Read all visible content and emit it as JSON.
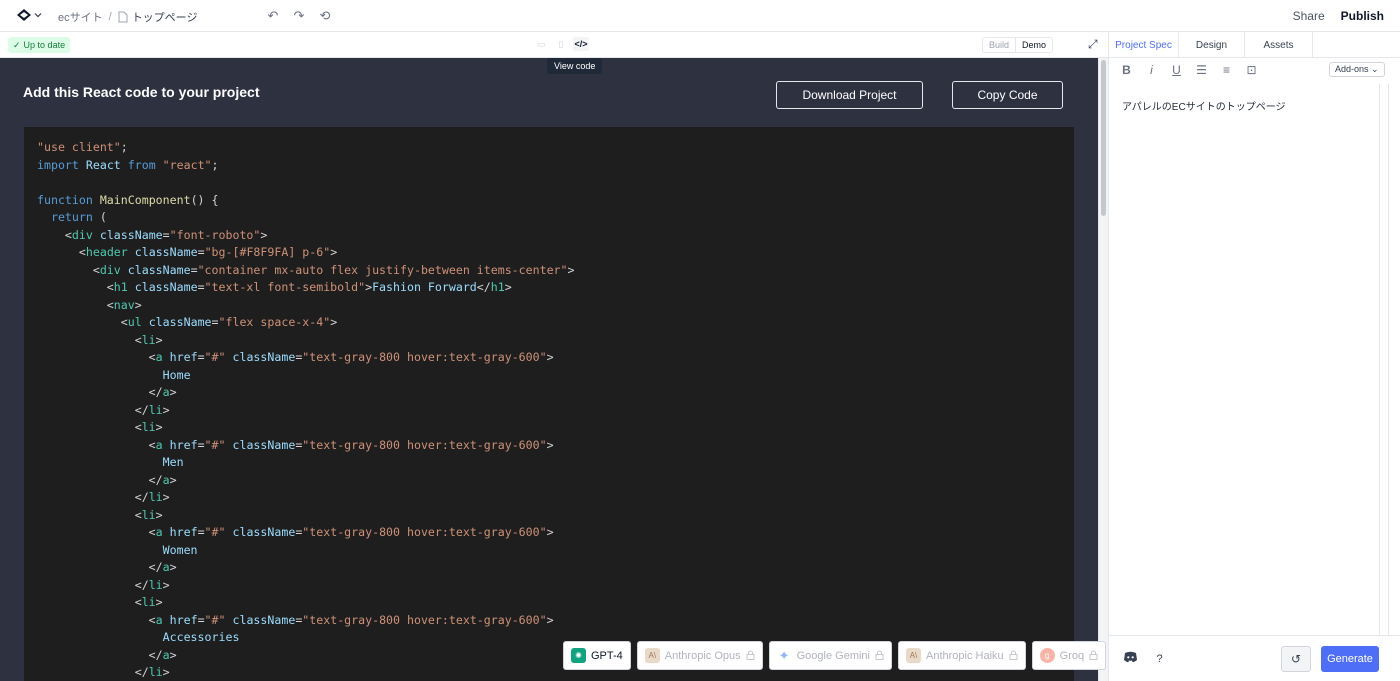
{
  "breadcrumb": {
    "project": "ecサイト",
    "separator": "/",
    "page": "トップページ"
  },
  "header": {
    "share": "Share",
    "publish": "Publish"
  },
  "status": {
    "label": "Up to date"
  },
  "mode": {
    "build": "Build",
    "demo": "Demo"
  },
  "tooltip": "View code",
  "main": {
    "title": "Add this React code to your project",
    "download_label": "Download Project",
    "copy_label": "Copy Code"
  },
  "code_lines": [
    [
      {
        "c": "s",
        "t": "\"use client\""
      },
      {
        "c": "p",
        "t": ";"
      }
    ],
    [
      {
        "c": "k",
        "t": "import"
      },
      {
        "c": "p",
        "t": " "
      },
      {
        "c": "v",
        "t": "React"
      },
      {
        "c": "p",
        "t": " "
      },
      {
        "c": "k",
        "t": "from"
      },
      {
        "c": "p",
        "t": " "
      },
      {
        "c": "s",
        "t": "\"react\""
      },
      {
        "c": "p",
        "t": ";"
      }
    ],
    [],
    [
      {
        "c": "k",
        "t": "function"
      },
      {
        "c": "p",
        "t": " "
      },
      {
        "c": "f",
        "t": "MainComponent"
      },
      {
        "c": "p",
        "t": "() {"
      }
    ],
    [
      {
        "c": "p",
        "t": "  "
      },
      {
        "c": "k",
        "t": "return"
      },
      {
        "c": "p",
        "t": " ("
      }
    ],
    [
      {
        "c": "p",
        "t": "    <"
      },
      {
        "c": "t",
        "t": "div"
      },
      {
        "c": "p",
        "t": " "
      },
      {
        "c": "a",
        "t": "className"
      },
      {
        "c": "p",
        "t": "="
      },
      {
        "c": "s",
        "t": "\"font-roboto\""
      },
      {
        "c": "p",
        "t": ">"
      }
    ],
    [
      {
        "c": "p",
        "t": "      <"
      },
      {
        "c": "t",
        "t": "header"
      },
      {
        "c": "p",
        "t": " "
      },
      {
        "c": "a",
        "t": "className"
      },
      {
        "c": "p",
        "t": "="
      },
      {
        "c": "s",
        "t": "\"bg-[#F8F9FA] p-6\""
      },
      {
        "c": "p",
        "t": ">"
      }
    ],
    [
      {
        "c": "p",
        "t": "        <"
      },
      {
        "c": "t",
        "t": "div"
      },
      {
        "c": "p",
        "t": " "
      },
      {
        "c": "a",
        "t": "className"
      },
      {
        "c": "p",
        "t": "="
      },
      {
        "c": "s",
        "t": "\"container mx-auto flex justify-between items-center\""
      },
      {
        "c": "p",
        "t": ">"
      }
    ],
    [
      {
        "c": "p",
        "t": "          <"
      },
      {
        "c": "t",
        "t": "h1"
      },
      {
        "c": "p",
        "t": " "
      },
      {
        "c": "a",
        "t": "className"
      },
      {
        "c": "p",
        "t": "="
      },
      {
        "c": "s",
        "t": "\"text-xl font-semibold\""
      },
      {
        "c": "p",
        "t": ">"
      },
      {
        "c": "v",
        "t": "Fashion Forward"
      },
      {
        "c": "p",
        "t": "</"
      },
      {
        "c": "t",
        "t": "h1"
      },
      {
        "c": "p",
        "t": ">"
      }
    ],
    [
      {
        "c": "p",
        "t": "          <"
      },
      {
        "c": "t",
        "t": "nav"
      },
      {
        "c": "p",
        "t": ">"
      }
    ],
    [
      {
        "c": "p",
        "t": "            <"
      },
      {
        "c": "t",
        "t": "ul"
      },
      {
        "c": "p",
        "t": " "
      },
      {
        "c": "a",
        "t": "className"
      },
      {
        "c": "p",
        "t": "="
      },
      {
        "c": "s",
        "t": "\"flex space-x-4\""
      },
      {
        "c": "p",
        "t": ">"
      }
    ],
    [
      {
        "c": "p",
        "t": "              <"
      },
      {
        "c": "t",
        "t": "li"
      },
      {
        "c": "p",
        "t": ">"
      }
    ],
    [
      {
        "c": "p",
        "t": "                <"
      },
      {
        "c": "t",
        "t": "a"
      },
      {
        "c": "p",
        "t": " "
      },
      {
        "c": "a",
        "t": "href"
      },
      {
        "c": "p",
        "t": "="
      },
      {
        "c": "s",
        "t": "\"#\""
      },
      {
        "c": "p",
        "t": " "
      },
      {
        "c": "a",
        "t": "className"
      },
      {
        "c": "p",
        "t": "="
      },
      {
        "c": "s",
        "t": "\"text-gray-800 hover:text-gray-600\""
      },
      {
        "c": "p",
        "t": ">"
      }
    ],
    [
      {
        "c": "p",
        "t": "                  "
      },
      {
        "c": "v",
        "t": "Home"
      }
    ],
    [
      {
        "c": "p",
        "t": "                </"
      },
      {
        "c": "t",
        "t": "a"
      },
      {
        "c": "p",
        "t": ">"
      }
    ],
    [
      {
        "c": "p",
        "t": "              </"
      },
      {
        "c": "t",
        "t": "li"
      },
      {
        "c": "p",
        "t": ">"
      }
    ],
    [
      {
        "c": "p",
        "t": "              <"
      },
      {
        "c": "t",
        "t": "li"
      },
      {
        "c": "p",
        "t": ">"
      }
    ],
    [
      {
        "c": "p",
        "t": "                <"
      },
      {
        "c": "t",
        "t": "a"
      },
      {
        "c": "p",
        "t": " "
      },
      {
        "c": "a",
        "t": "href"
      },
      {
        "c": "p",
        "t": "="
      },
      {
        "c": "s",
        "t": "\"#\""
      },
      {
        "c": "p",
        "t": " "
      },
      {
        "c": "a",
        "t": "className"
      },
      {
        "c": "p",
        "t": "="
      },
      {
        "c": "s",
        "t": "\"text-gray-800 hover:text-gray-600\""
      },
      {
        "c": "p",
        "t": ">"
      }
    ],
    [
      {
        "c": "p",
        "t": "                  "
      },
      {
        "c": "v",
        "t": "Men"
      }
    ],
    [
      {
        "c": "p",
        "t": "                </"
      },
      {
        "c": "t",
        "t": "a"
      },
      {
        "c": "p",
        "t": ">"
      }
    ],
    [
      {
        "c": "p",
        "t": "              </"
      },
      {
        "c": "t",
        "t": "li"
      },
      {
        "c": "p",
        "t": ">"
      }
    ],
    [
      {
        "c": "p",
        "t": "              <"
      },
      {
        "c": "t",
        "t": "li"
      },
      {
        "c": "p",
        "t": ">"
      }
    ],
    [
      {
        "c": "p",
        "t": "                <"
      },
      {
        "c": "t",
        "t": "a"
      },
      {
        "c": "p",
        "t": " "
      },
      {
        "c": "a",
        "t": "href"
      },
      {
        "c": "p",
        "t": "="
      },
      {
        "c": "s",
        "t": "\"#\""
      },
      {
        "c": "p",
        "t": " "
      },
      {
        "c": "a",
        "t": "className"
      },
      {
        "c": "p",
        "t": "="
      },
      {
        "c": "s",
        "t": "\"text-gray-800 hover:text-gray-600\""
      },
      {
        "c": "p",
        "t": ">"
      }
    ],
    [
      {
        "c": "p",
        "t": "                  "
      },
      {
        "c": "v",
        "t": "Women"
      }
    ],
    [
      {
        "c": "p",
        "t": "                </"
      },
      {
        "c": "t",
        "t": "a"
      },
      {
        "c": "p",
        "t": ">"
      }
    ],
    [
      {
        "c": "p",
        "t": "              </"
      },
      {
        "c": "t",
        "t": "li"
      },
      {
        "c": "p",
        "t": ">"
      }
    ],
    [
      {
        "c": "p",
        "t": "              <"
      },
      {
        "c": "t",
        "t": "li"
      },
      {
        "c": "p",
        "t": ">"
      }
    ],
    [
      {
        "c": "p",
        "t": "                <"
      },
      {
        "c": "t",
        "t": "a"
      },
      {
        "c": "p",
        "t": " "
      },
      {
        "c": "a",
        "t": "href"
      },
      {
        "c": "p",
        "t": "="
      },
      {
        "c": "s",
        "t": "\"#\""
      },
      {
        "c": "p",
        "t": " "
      },
      {
        "c": "a",
        "t": "className"
      },
      {
        "c": "p",
        "t": "="
      },
      {
        "c": "s",
        "t": "\"text-gray-800 hover:text-gray-600\""
      },
      {
        "c": "p",
        "t": ">"
      }
    ],
    [
      {
        "c": "p",
        "t": "                  "
      },
      {
        "c": "v",
        "t": "Accessories"
      }
    ],
    [
      {
        "c": "p",
        "t": "                </"
      },
      {
        "c": "t",
        "t": "a"
      },
      {
        "c": "p",
        "t": ">"
      }
    ],
    [
      {
        "c": "p",
        "t": "              </"
      },
      {
        "c": "t",
        "t": "li"
      },
      {
        "c": "p",
        "t": ">"
      }
    ]
  ],
  "models": [
    {
      "label": "GPT-4",
      "icon": "openai-icon",
      "active": true,
      "locked": false
    },
    {
      "label": "Anthropic Opus",
      "icon": "anthropic-icon",
      "active": false,
      "locked": true
    },
    {
      "label": "Google Gemini",
      "icon": "gemini-icon",
      "active": false,
      "locked": true
    },
    {
      "label": "Anthropic Haiku",
      "icon": "anthropic-icon",
      "active": false,
      "locked": true
    },
    {
      "label": "Groq",
      "icon": "groq-icon",
      "active": false,
      "locked": true
    }
  ],
  "panel": {
    "tabs": [
      "Project Spec",
      "Design",
      "Assets"
    ],
    "addons": "Add-ons",
    "spec_text": "アパレルのECサイトのトップページ",
    "generate": "Generate"
  },
  "colors": {
    "accent": "#4f6ef7",
    "code_bg": "#1e1e1e",
    "main_bg": "#2e3140"
  }
}
